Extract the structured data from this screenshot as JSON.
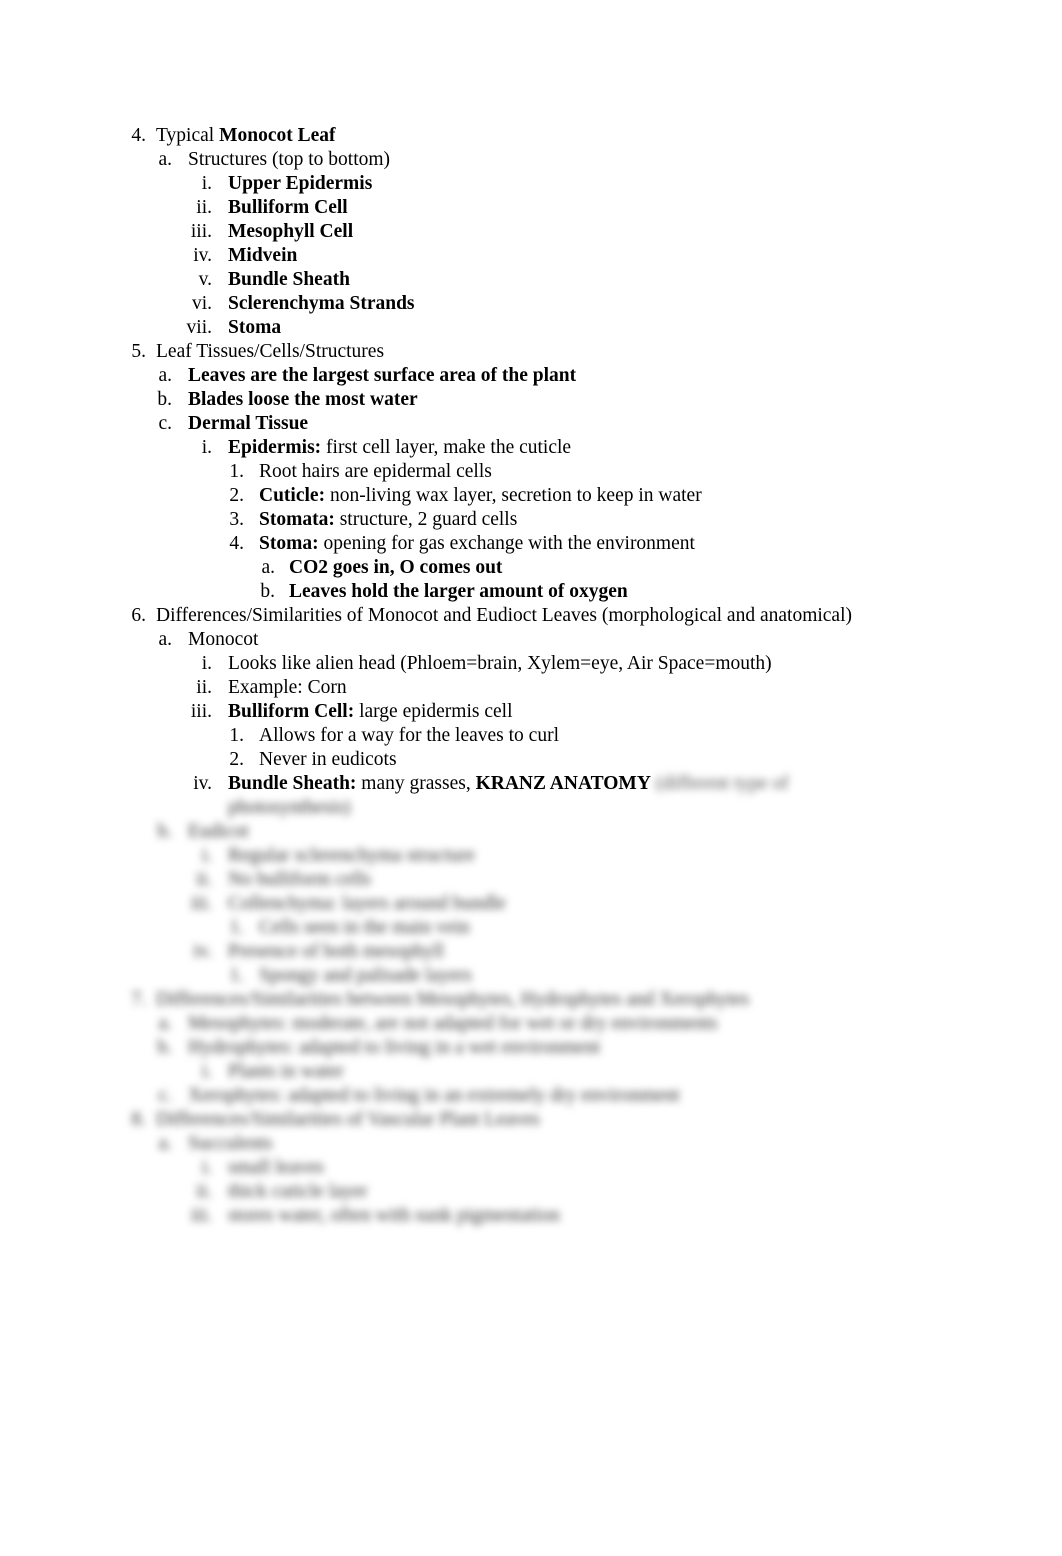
{
  "document": {
    "items": [
      {
        "level": 1,
        "marker": "4.",
        "parts": [
          {
            "t": "Typical ",
            "b": false
          },
          {
            "t": "Monocot Leaf",
            "b": true
          }
        ]
      },
      {
        "level": 2,
        "marker": "a.",
        "parts": [
          {
            "t": "Structures (top to bottom)",
            "b": false
          }
        ]
      },
      {
        "level": 3,
        "marker": "i.",
        "parts": [
          {
            "t": "Upper Epidermis",
            "b": true
          }
        ]
      },
      {
        "level": 3,
        "marker": "ii.",
        "parts": [
          {
            "t": "Bulliform Cell",
            "b": true
          }
        ]
      },
      {
        "level": 3,
        "marker": "iii.",
        "parts": [
          {
            "t": "Mesophyll Cell",
            "b": true
          }
        ]
      },
      {
        "level": 3,
        "marker": "iv.",
        "parts": [
          {
            "t": "Midvein",
            "b": true
          }
        ]
      },
      {
        "level": 3,
        "marker": "v.",
        "parts": [
          {
            "t": "Bundle Sheath",
            "b": true
          }
        ]
      },
      {
        "level": 3,
        "marker": "vi.",
        "parts": [
          {
            "t": "Sclerenchyma Strands",
            "b": true
          }
        ]
      },
      {
        "level": 3,
        "marker": "vii.",
        "parts": [
          {
            "t": "Stoma",
            "b": true
          }
        ]
      },
      {
        "level": 1,
        "marker": "5.",
        "parts": [
          {
            "t": "Leaf Tissues/Cells/Structures",
            "b": false
          }
        ]
      },
      {
        "level": 2,
        "marker": "a.",
        "parts": [
          {
            "t": "Leaves are the largest surface area of the plant",
            "b": true
          }
        ]
      },
      {
        "level": 2,
        "marker": "b.",
        "parts": [
          {
            "t": "Blades loose the most water",
            "b": true
          }
        ]
      },
      {
        "level": 2,
        "marker": "c.",
        "parts": [
          {
            "t": "Dermal Tissue",
            "b": true
          }
        ]
      },
      {
        "level": 3,
        "marker": "i.",
        "parts": [
          {
            "t": "Epidermis:",
            "b": true
          },
          {
            "t": " first cell layer, make the cuticle",
            "b": false
          }
        ]
      },
      {
        "level": 4,
        "marker": "1.",
        "parts": [
          {
            "t": "Root hairs are epidermal cells",
            "b": false
          }
        ]
      },
      {
        "level": 4,
        "marker": "2.",
        "parts": [
          {
            "t": "Cuticle:",
            "b": true
          },
          {
            "t": " non-living wax layer, secretion to keep in water",
            "b": false
          }
        ]
      },
      {
        "level": 4,
        "marker": "3.",
        "parts": [
          {
            "t": "Stomata:",
            "b": true
          },
          {
            "t": " structure, 2 guard cells",
            "b": false
          }
        ]
      },
      {
        "level": 4,
        "marker": "4.",
        "parts": [
          {
            "t": "Stoma:",
            "b": true
          },
          {
            "t": " opening for gas exchange with the environment",
            "b": false
          }
        ]
      },
      {
        "level": 5,
        "marker": "a.",
        "parts": [
          {
            "t": "CO2 goes in, O comes out",
            "b": true
          }
        ]
      },
      {
        "level": 5,
        "marker": "b.",
        "parts": [
          {
            "t": "Leaves hold the larger amount of oxygen",
            "b": true
          }
        ]
      },
      {
        "level": 1,
        "marker": "6.",
        "parts": [
          {
            "t": "Differences/Similarities of Monocot and Eudioct Leaves (morphological and anatomical)",
            "b": false
          }
        ]
      },
      {
        "level": 2,
        "marker": "a.",
        "parts": [
          {
            "t": "Monocot",
            "b": false
          }
        ]
      },
      {
        "level": 3,
        "marker": "i.",
        "parts": [
          {
            "t": "Looks like alien head (Phloem=brain, Xylem=eye, Air Space=mouth)",
            "b": false
          }
        ]
      },
      {
        "level": 3,
        "marker": "ii.",
        "parts": [
          {
            "t": "Example: Corn",
            "b": false
          }
        ]
      },
      {
        "level": 3,
        "marker": "iii.",
        "parts": [
          {
            "t": "Bulliform Cell:",
            "b": true
          },
          {
            "t": " large epidermis cell",
            "b": false
          }
        ]
      },
      {
        "level": 4,
        "marker": "1.",
        "parts": [
          {
            "t": "Allows for a way for the leaves to curl",
            "b": false
          }
        ]
      },
      {
        "level": 4,
        "marker": "2.",
        "parts": [
          {
            "t": "Never in eudicots",
            "b": false
          }
        ]
      },
      {
        "level": 3,
        "marker": "iv.",
        "parts": [
          {
            "t": "Bundle Sheath:",
            "b": true
          },
          {
            "t": " many grasses, ",
            "b": false
          },
          {
            "t": "KRANZ ANATOMY",
            "b": true
          },
          {
            "t": " (different type of",
            "b": false,
            "blur": true
          }
        ]
      }
    ],
    "blurred_items": [
      {
        "level": 3,
        "marker": "",
        "text": "photosynthesis)"
      },
      {
        "level": 2,
        "marker": "b.",
        "text": "Eudicot"
      },
      {
        "level": 3,
        "marker": "i.",
        "text": "Regular sclerenchyma structure"
      },
      {
        "level": 3,
        "marker": "ii.",
        "text": "No bulliform cells"
      },
      {
        "level": 3,
        "marker": "iii.",
        "text": "Collenchyma: layers around bundle"
      },
      {
        "level": 4,
        "marker": "1.",
        "text": "Cells seen in the main vein"
      },
      {
        "level": 3,
        "marker": "iv.",
        "text": "Presence of both mesophyll"
      },
      {
        "level": 4,
        "marker": "1.",
        "text": "Spongy and palisade layers"
      },
      {
        "level": 1,
        "marker": "7.",
        "text": "Differences/Similarities between Mesophytes, Hydrophytes and Xerophytes"
      },
      {
        "level": 2,
        "marker": "a.",
        "text": "Mesophytes: moderate, are not adapted for wet or dry environments"
      },
      {
        "level": 2,
        "marker": "b.",
        "text": "Hydrophytes: adapted to living in a wet environment"
      },
      {
        "level": 3,
        "marker": "i.",
        "text": "Plants in water"
      },
      {
        "level": 2,
        "marker": "c.",
        "text": "Xerophytes: adapted to living in an extremely dry environment"
      },
      {
        "level": 1,
        "marker": "8.",
        "text": "Differences/Similarities of Vascular Plant Leaves"
      },
      {
        "level": 2,
        "marker": "a.",
        "text": "Succulents"
      },
      {
        "level": 3,
        "marker": "i.",
        "text": "small leaves"
      },
      {
        "level": 3,
        "marker": "ii.",
        "text": "thick cuticle layer"
      },
      {
        "level": 3,
        "marker": "iii.",
        "text": "stores water, often with sunk pigmentation"
      }
    ]
  }
}
